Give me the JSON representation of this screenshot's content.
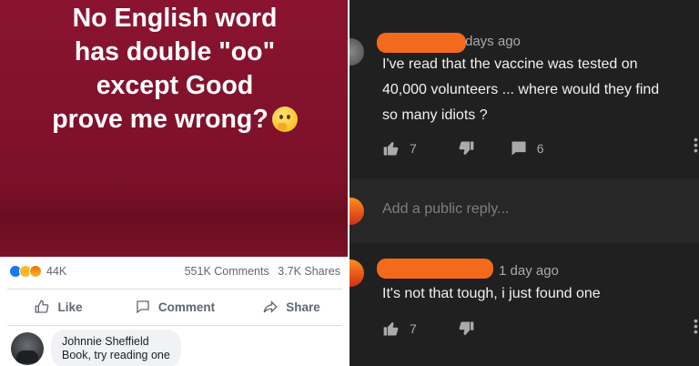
{
  "facebook": {
    "post_lines": [
      "No English word",
      "has double \"oo\"",
      "except Good",
      "prove me wrong?"
    ],
    "post_emoji": "thinking-face-emoji",
    "reactions_count": "44K",
    "comments_count": "551K Comments",
    "shares_count": "3.7K Shares",
    "actions": {
      "like": "Like",
      "comment": "Comment",
      "share": "Share"
    },
    "comment": {
      "author": "Johnnie Sheffield",
      "text": "Book, try reading one"
    },
    "colors": {
      "post_bg": "#8a1430",
      "like_blue": "#1877f2"
    }
  },
  "youtube": {
    "comment1": {
      "time": "days ago",
      "text_lines": [
        "I've read that the vaccine was tested on",
        "40,000 volunteers ... where would they find",
        "so many idiots ?"
      ],
      "likes": "7",
      "replies": "6"
    },
    "reply_placeholder": "Add a public reply...",
    "comment2": {
      "time": "1 day ago",
      "text": "It's not that tough, i just found one",
      "likes": "7"
    },
    "colors": {
      "bg": "#202020",
      "redaction": "#f36a1c"
    }
  }
}
